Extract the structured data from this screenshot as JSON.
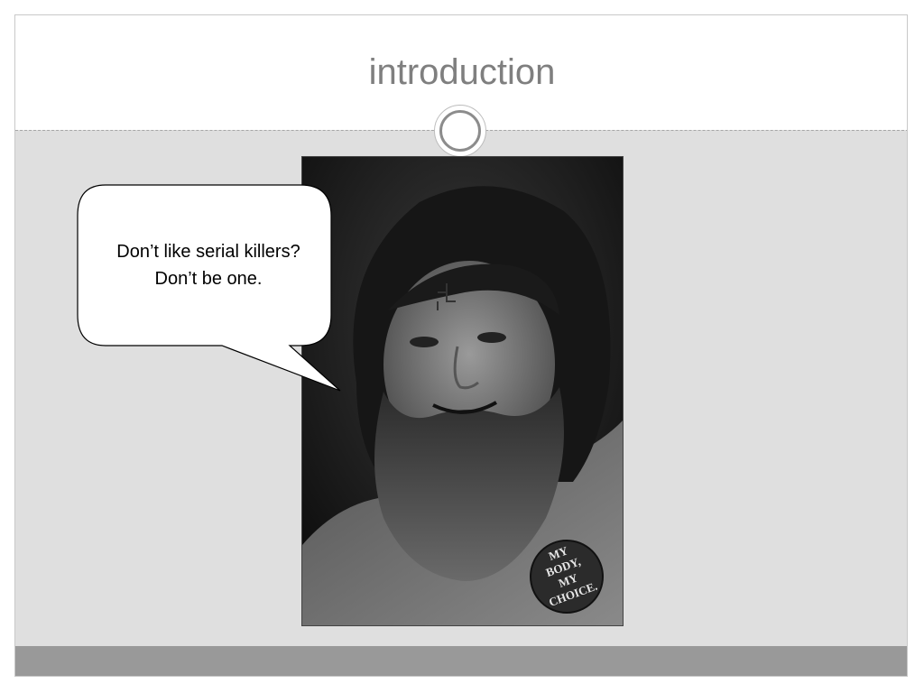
{
  "slide": {
    "title": "introduction",
    "speech_bubble": {
      "line1": "Don’t like serial killers?",
      "line2": "Don’t be one."
    },
    "photo": {
      "button_text": [
        "MY",
        "BODY,",
        "MY",
        "CHOICE."
      ]
    }
  },
  "colors": {
    "title": "#7f7f7f",
    "content_background": "#dfdfdf",
    "footer_band": "#999999"
  }
}
